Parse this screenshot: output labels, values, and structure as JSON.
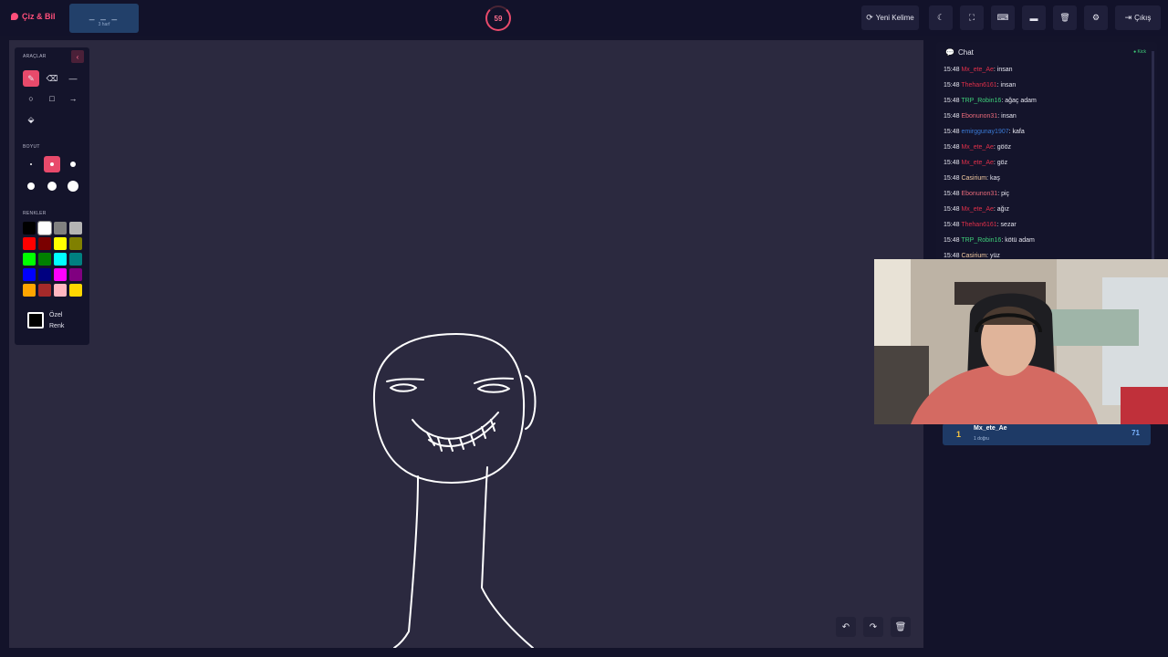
{
  "header": {
    "logo": "Çiz & Bil",
    "word": "_ _ _",
    "word_hint": "3 harf",
    "timer": "59",
    "buttons": {
      "new_word": "Yeni Kelime",
      "exit": "Çıkış"
    }
  },
  "toolpanel": {
    "tools_label": "ARAÇLAR",
    "size_label": "BOYUT",
    "colors_label": "RENKLER",
    "custom_color": "Özel",
    "custom_color_2": "Renk",
    "colors": [
      [
        "#000000",
        "#ffffff",
        "#808080",
        "#b4b4b4"
      ],
      [
        "#ff0000",
        "#7a0000",
        "#ffff00",
        "#808000"
      ],
      [
        "#00ff00",
        "#008000",
        "#00ffff",
        "#008080"
      ],
      [
        "#0000ff",
        "#000080",
        "#ff00ff",
        "#800080"
      ],
      [
        "#ffa500",
        "#a52a2a",
        "#ffb6c1",
        "#ffd700"
      ]
    ],
    "accent": "#e84a6b"
  },
  "chat": {
    "title": "Chat",
    "status": "Kick",
    "messages": [
      {
        "time": "15:48",
        "user": "Mx_ete_Ae",
        "color": "#e0304a",
        "text": ": insan"
      },
      {
        "time": "15:48",
        "user": "Thehan6161",
        "color": "#e0304a",
        "text": ": insan"
      },
      {
        "time": "15:48",
        "user": "TRP_Robin16",
        "color": "#3fd07a",
        "text": ": ağaç adam"
      },
      {
        "time": "15:48",
        "user": "Ebonunon31",
        "color": "#e86a7a",
        "text": ": insan"
      },
      {
        "time": "15:48",
        "user": "emirggunay1907",
        "color": "#3a7ad6",
        "text": ": kafa"
      },
      {
        "time": "15:48",
        "user": "Mx_ete_Ae",
        "color": "#e0304a",
        "text": ": gööz"
      },
      {
        "time": "15:48",
        "user": "Mx_ete_Ae",
        "color": "#e0304a",
        "text": ": göz"
      },
      {
        "time": "15:48",
        "user": "Casirium",
        "color": "#f2c9a0",
        "text": ": kaş"
      },
      {
        "time": "15:48",
        "user": "Ebonunon31",
        "color": "#e86a7a",
        "text": ": piç"
      },
      {
        "time": "15:48",
        "user": "Mx_ete_Ae",
        "color": "#e0304a",
        "text": ": ağız"
      },
      {
        "time": "15:48",
        "user": "Thehan6161",
        "color": "#e0304a",
        "text": ": sezar"
      },
      {
        "time": "15:48",
        "user": "TRP_Robin16",
        "color": "#3fd07a",
        "text": ": kötü adam"
      },
      {
        "time": "15:48",
        "user": "Casirium",
        "color": "#f2c9a0",
        "text": ": yüz"
      }
    ]
  },
  "leaderboard": [
    {
      "rank": "1",
      "name": "Mx_ete_Ae",
      "sub": "1 doğru",
      "score": "71"
    }
  ]
}
